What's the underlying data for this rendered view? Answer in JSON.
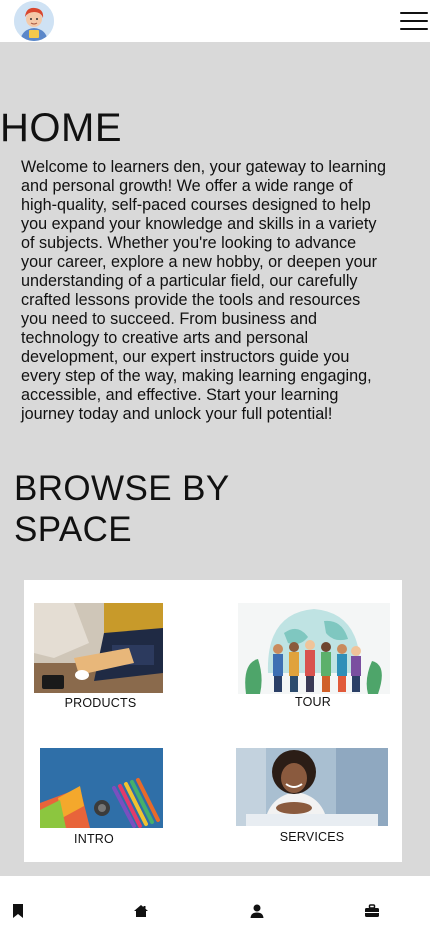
{
  "header": {
    "avatar_icon": "user-avatar-cartoon",
    "menu_icon": "hamburger-menu-icon"
  },
  "home": {
    "title": "HOME",
    "intro": "Welcome to learners den, your gateway to learning and personal growth! We offer a wide range of high-quality, self-paced courses designed to help you expand your knowledge and skills in a variety of subjects. Whether you're looking to advance your career, explore a new hobby, or deepen your understanding of a particular field, our carefully crafted lessons provide the tools and resources you need to succeed. From business and technology to creative arts and personal development, our expert instructors guide you every step of the way, making learning engaging, accessible, and effective. Start your learning journey today and unlock your full potential!"
  },
  "browse": {
    "title": "BROWSE BY SPACE",
    "tiles": [
      {
        "label": "PRODUCTS",
        "image": "laptop-desk-photo"
      },
      {
        "label": "TOUR",
        "image": "students-globe-illustration"
      },
      {
        "label": "INTRO",
        "image": "school-supplies-photo"
      },
      {
        "label": "SERVICES",
        "image": "smiling-woman-photo"
      }
    ]
  },
  "bottom_nav": {
    "items": [
      {
        "icon": "bookmark-icon"
      },
      {
        "icon": "home-icon"
      },
      {
        "icon": "user-icon"
      },
      {
        "icon": "briefcase-icon"
      }
    ]
  },
  "colors": {
    "page_background": "#d9d9d9",
    "surface": "#ffffff",
    "text": "#111111"
  }
}
